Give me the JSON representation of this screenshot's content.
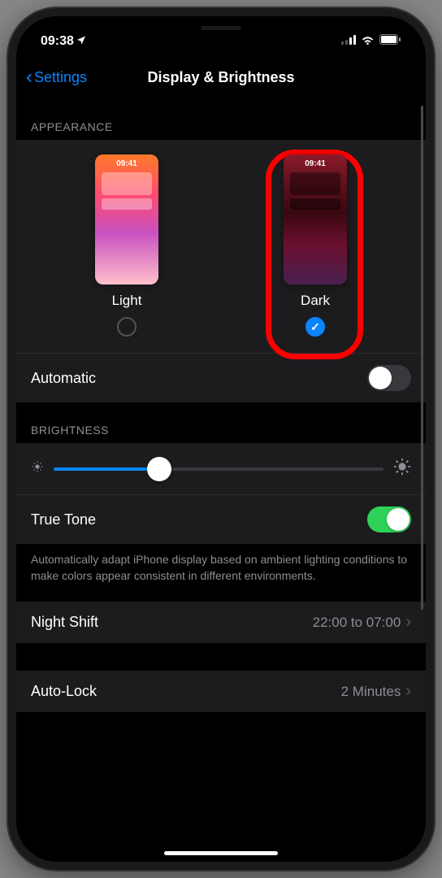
{
  "status": {
    "time": "09:38",
    "location_icon": "location-arrow"
  },
  "nav": {
    "back_label": "Settings",
    "title": "Display & Brightness"
  },
  "appearance": {
    "header": "APPEARANCE",
    "preview_time": "09:41",
    "light_label": "Light",
    "dark_label": "Dark",
    "selected": "dark",
    "automatic_label": "Automatic",
    "automatic_on": false
  },
  "brightness": {
    "header": "BRIGHTNESS",
    "value_percent": 32,
    "true_tone_label": "True Tone",
    "true_tone_on": true,
    "footer": "Automatically adapt iPhone display based on ambient lighting conditions to make colors appear consistent in different environments."
  },
  "night_shift": {
    "label": "Night Shift",
    "value": "22:00 to 07:00"
  },
  "auto_lock": {
    "label": "Auto-Lock",
    "value": "2 Minutes"
  }
}
